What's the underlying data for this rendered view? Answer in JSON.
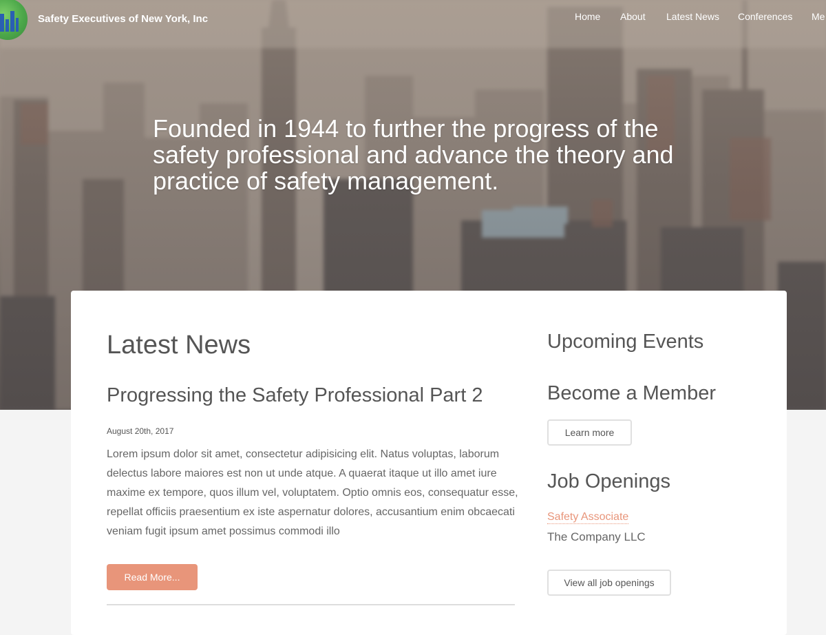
{
  "header": {
    "site_title": "Safety Executives of New York, Inc",
    "nav": [
      {
        "label": "Home"
      },
      {
        "label": "About"
      },
      {
        "label": "Latest News"
      },
      {
        "label": "Conferences"
      },
      {
        "label": "Me"
      }
    ]
  },
  "hero": {
    "tagline": "Founded in 1944 to further the progress of the safety professional and advance the theory and practice of safety management."
  },
  "main": {
    "heading": "Latest News",
    "post": {
      "title": "Progressing the Safety Professional Part 2",
      "date": "August 20th, 2017",
      "excerpt": "Lorem ipsum dolor sit amet, consectetur adipisicing elit. Natus voluptas, laborum delectus labore maiores est non ut unde atque. A quaerat itaque ut illo amet iure maxime ex tempore, quos illum vel, voluptatem. Optio omnis eos, consequatur esse, repellat officiis praesentium ex iste aspernatur dolores, accusantium enim obcaecati veniam fugit ipsum amet possimus commodi illo",
      "read_more_label": "Read More..."
    }
  },
  "sidebar": {
    "events_heading": "Upcoming Events",
    "member_heading": "Become a Member",
    "learn_more_label": "Learn more",
    "jobs_heading": "Job Openings",
    "job": {
      "title": "Safety Associate",
      "company": "The Company LLC"
    },
    "view_all_label": "View all job openings"
  },
  "colors": {
    "accent": "#e8957a",
    "heading_text": "#555555",
    "body_text": "#666666",
    "card_bg": "#ffffff",
    "page_bg": "#f4f4f4"
  },
  "icons": {
    "logo": "city-globe-logo"
  }
}
